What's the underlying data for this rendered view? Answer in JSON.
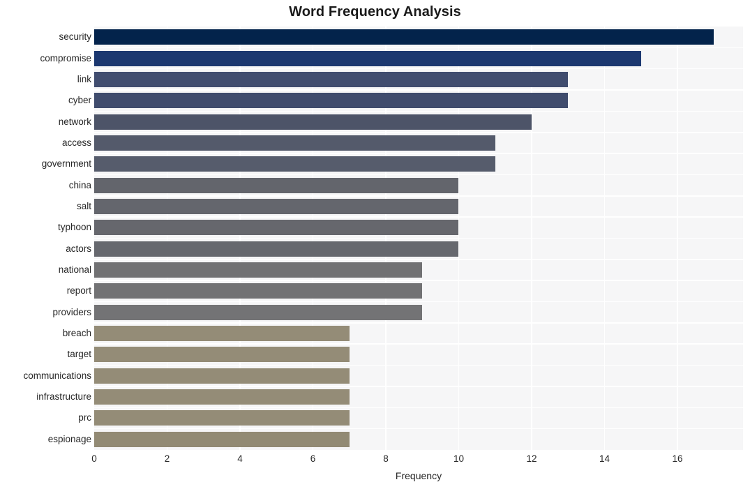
{
  "chart_data": {
    "type": "bar",
    "orientation": "horizontal",
    "title": "Word Frequency Analysis",
    "xlabel": "Frequency",
    "ylabel": "",
    "categories": [
      "security",
      "compromise",
      "link",
      "cyber",
      "network",
      "access",
      "government",
      "china",
      "salt",
      "typhoon",
      "actors",
      "national",
      "report",
      "providers",
      "breach",
      "target",
      "communications",
      "infrastructure",
      "prc",
      "espionage"
    ],
    "values": [
      17,
      15,
      13,
      13,
      12,
      11,
      11,
      10,
      10,
      10,
      10,
      9,
      9,
      9,
      7,
      7,
      7,
      7,
      7,
      7
    ],
    "bar_colors": [
      "#03234b",
      "#1c3870",
      "#414d6f",
      "#404c6d",
      "#4d5468",
      "#545a6b",
      "#565c6c",
      "#63656c",
      "#64666d",
      "#66676d",
      "#66686e",
      "#717173",
      "#727274",
      "#737375",
      "#948c77",
      "#948c77",
      "#948c77",
      "#948c77",
      "#948c77",
      "#928a74"
    ],
    "xlim": [
      0,
      17.8
    ],
    "xticks": [
      0,
      2,
      4,
      6,
      8,
      10,
      12,
      14,
      16
    ],
    "xtick_labels": [
      "0",
      "2",
      "4",
      "6",
      "8",
      "10",
      "12",
      "14",
      "16"
    ],
    "grid": true,
    "grid_color": "#ffffff",
    "plot_background": "#f6f6f7",
    "figure_background": "#ffffff",
    "legend": null
  }
}
